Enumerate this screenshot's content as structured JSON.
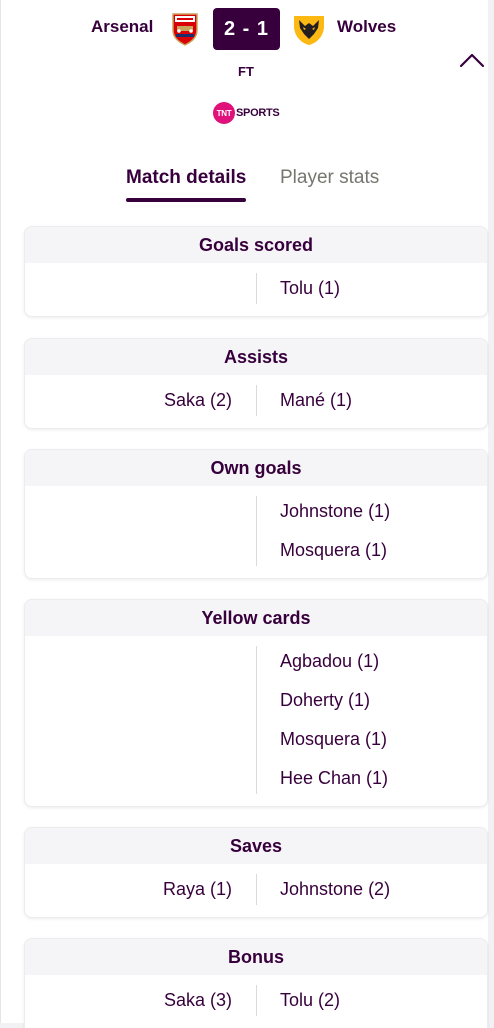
{
  "match": {
    "home_team": "Arsenal",
    "away_team": "Wolves",
    "score": "2 - 1",
    "status": "FT",
    "broadcaster_badge": "TNT",
    "broadcaster_name": "SPORTS",
    "home_crest_icon": "arsenal-crest-icon",
    "away_crest_icon": "wolves-crest-icon",
    "collapse_icon": "chevron-up-icon"
  },
  "tabs": [
    {
      "label": "Match details",
      "active": true
    },
    {
      "label": "Player stats",
      "active": false
    }
  ],
  "stats": [
    {
      "title": "Goals scored",
      "rows": [
        {
          "home": "",
          "away": "Tolu (1)"
        }
      ]
    },
    {
      "title": "Assists",
      "rows": [
        {
          "home": "Saka (2)",
          "away": "Mané (1)"
        }
      ]
    },
    {
      "title": "Own goals",
      "rows": [
        {
          "home": "",
          "away": "Johnstone (1)"
        },
        {
          "home": "",
          "away": "Mosquera (1)"
        }
      ]
    },
    {
      "title": "Yellow cards",
      "rows": [
        {
          "home": "",
          "away": "Agbadou (1)"
        },
        {
          "home": "",
          "away": "Doherty (1)"
        },
        {
          "home": "",
          "away": "Mosquera (1)"
        },
        {
          "home": "",
          "away": "Hee Chan (1)"
        }
      ]
    },
    {
      "title": "Saves",
      "rows": [
        {
          "home": "Raya (1)",
          "away": "Johnstone (2)"
        }
      ]
    },
    {
      "title": "Bonus",
      "rows": [
        {
          "home": "Saka (3)",
          "away": "Tolu (2)"
        }
      ]
    }
  ],
  "colors": {
    "primary": "#37003c",
    "tnt_pink": "#e0117a",
    "arsenal_red": "#db0007",
    "wolves_gold": "#fdb913"
  }
}
